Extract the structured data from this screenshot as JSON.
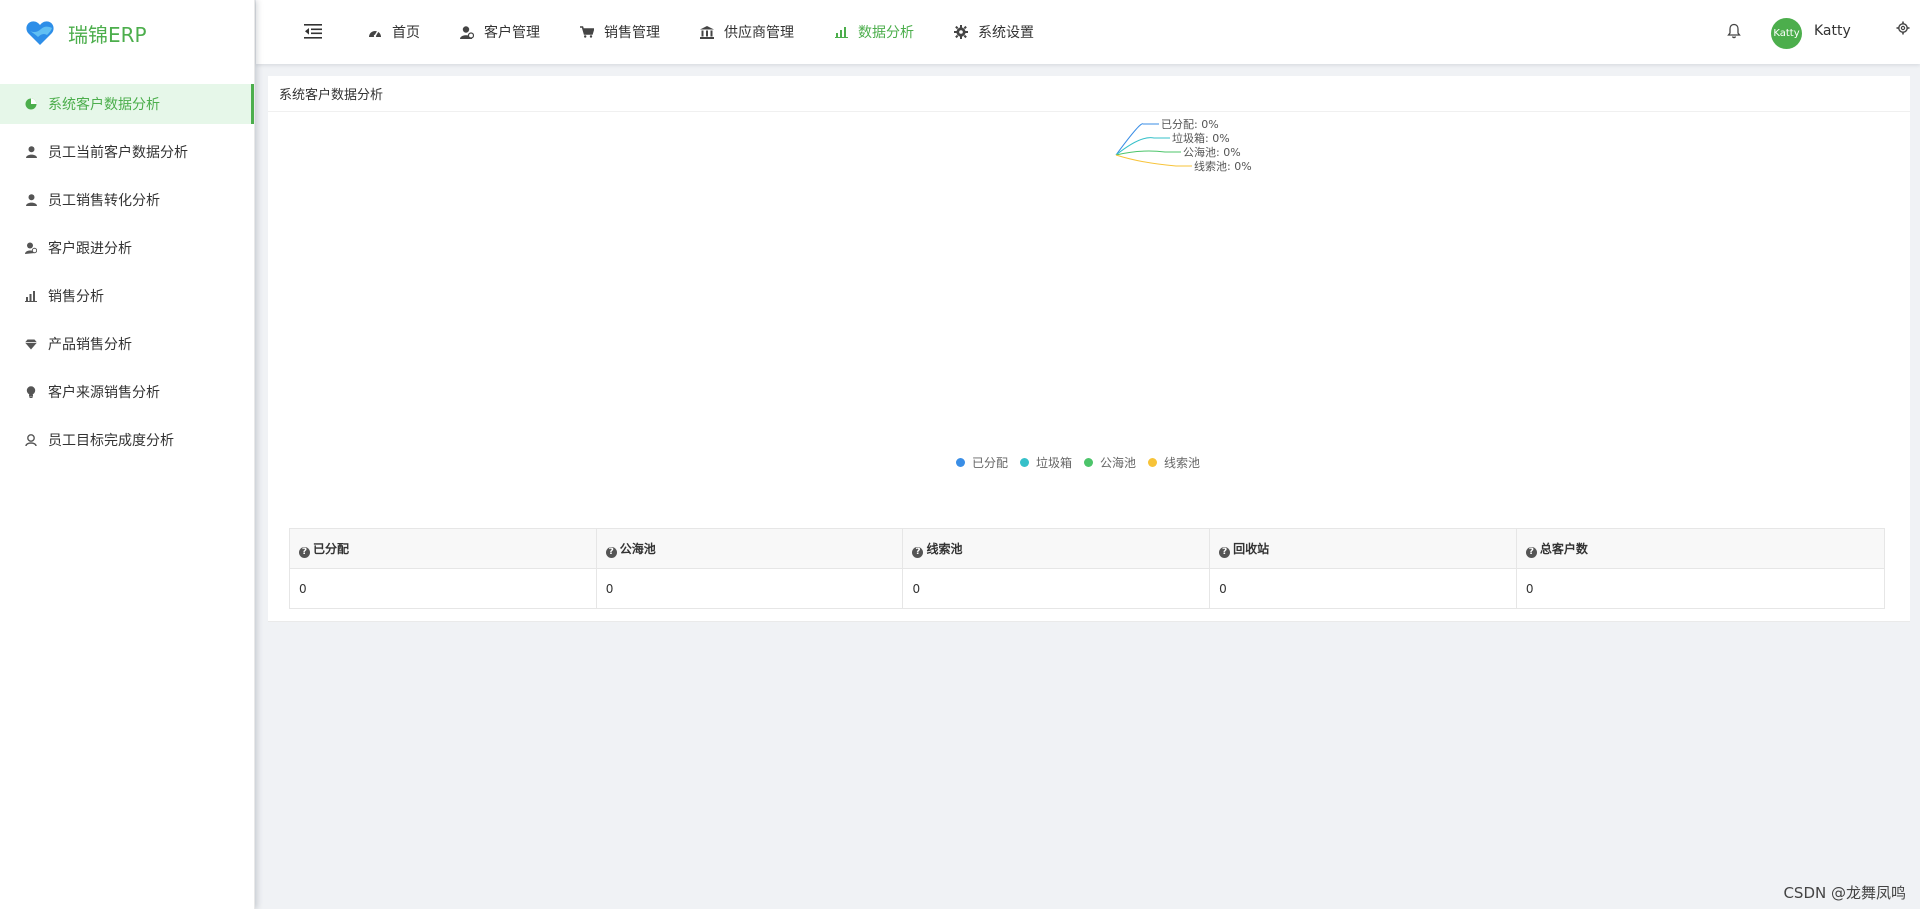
{
  "brand": {
    "name": "瑞锦ERP"
  },
  "sidebar": {
    "items": [
      {
        "label": "系统客户数据分析",
        "icon": "pie-chart-icon"
      },
      {
        "label": "员工当前客户数据分析",
        "icon": "user-icon"
      },
      {
        "label": "员工销售转化分析",
        "icon": "user-icon"
      },
      {
        "label": "客户跟进分析",
        "icon": "user-follow-icon"
      },
      {
        "label": "销售分析",
        "icon": "bar-chart-icon"
      },
      {
        "label": "产品销售分析",
        "icon": "diamond-icon"
      },
      {
        "label": "客户来源销售分析",
        "icon": "lightbulb-icon"
      },
      {
        "label": "员工目标完成度分析",
        "icon": "target-user-icon"
      }
    ]
  },
  "header": {
    "nav": [
      {
        "label": "首页",
        "icon": "dashboard-icon"
      },
      {
        "label": "客户管理",
        "icon": "users-icon"
      },
      {
        "label": "销售管理",
        "icon": "cart-icon"
      },
      {
        "label": "供应商管理",
        "icon": "bank-icon"
      },
      {
        "label": "数据分析",
        "icon": "bar-chart-icon"
      },
      {
        "label": "系统设置",
        "icon": "gear-icon"
      }
    ],
    "user": {
      "name": "Katty",
      "avatar_text": "Katty"
    }
  },
  "card": {
    "title": "系统客户数据分析"
  },
  "chart_data": {
    "type": "pie",
    "series": [
      {
        "name": "已分配",
        "value": 0,
        "label": "已分配: 0%",
        "color": "#3a8ee6"
      },
      {
        "name": "垃圾箱",
        "value": 0,
        "label": "垃圾箱: 0%",
        "color": "#36c0c9"
      },
      {
        "name": "公海池",
        "value": 0,
        "label": "公海池: 0%",
        "color": "#4cc46a"
      },
      {
        "name": "线索池",
        "value": 0,
        "label": "线索池: 0%",
        "color": "#f7c338"
      }
    ],
    "legend_position": "bottom-center"
  },
  "table": {
    "headers": [
      "已分配",
      "公海池",
      "线索池",
      "回收站",
      "总客户数"
    ],
    "rows": [
      [
        "0",
        "0",
        "0",
        "0",
        "0"
      ]
    ]
  },
  "watermark": "CSDN @龙舞凤鸣",
  "colors": {
    "accent": "#4cae4c"
  }
}
